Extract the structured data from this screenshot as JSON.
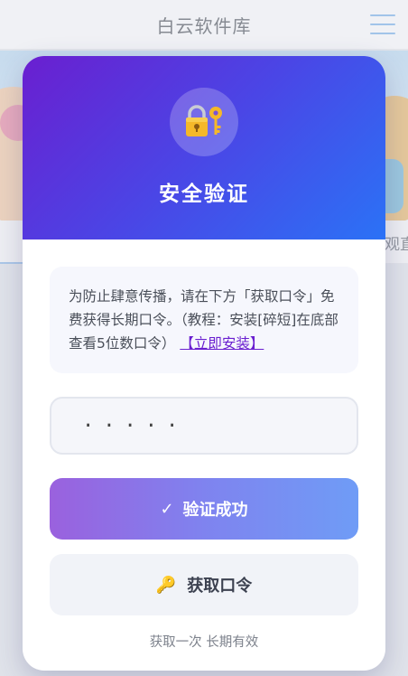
{
  "app": {
    "title": "白云软件库"
  },
  "background": {
    "tab_right_label": "观直"
  },
  "modal": {
    "title": "安全验证",
    "icon": "lock-with-key-icon",
    "notice_text": "为防止肆意传播，请在下方「获取口令」免费获得长期口令。（教程：安装[碎短]在底部查看5位数口令）",
    "install_link": "【立即安装】",
    "code_input_value": "·····",
    "verify_button": {
      "icon": "✓",
      "label": "验证成功"
    },
    "get_code_button": {
      "icon": "🔑",
      "label": "获取口令"
    },
    "footnote": "获取一次 长期有效"
  },
  "colors": {
    "header_gradient_start": "#6a1fd0",
    "header_gradient_end": "#2b72f6",
    "link": "#6a1fd0",
    "verify_gradient_start": "#9a61de",
    "verify_gradient_end": "#6f9cf6"
  }
}
